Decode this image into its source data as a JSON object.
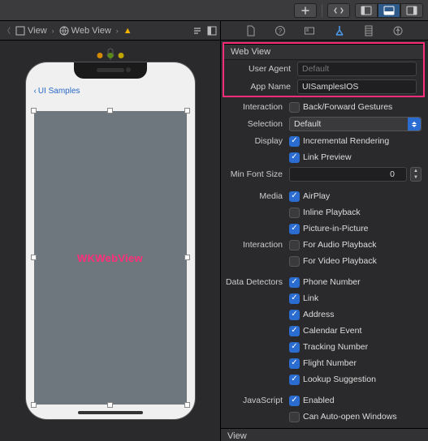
{
  "toolbar": {
    "add_tooltip": "Add",
    "nav_tooltip": "Navigate"
  },
  "breadcrumb": {
    "view": "View",
    "webview": "Web View"
  },
  "canvas": {
    "back_label": "UI Samples",
    "center_label": "WKWebView"
  },
  "inspector": {
    "section_webview": "Web View",
    "section_view": "View",
    "user_agent_label": "User Agent",
    "user_agent_placeholder": "Default",
    "app_name_label": "App Name",
    "app_name_value": "UISamplesIOS",
    "interaction_label": "Interaction",
    "interaction_gestures": "Back/Forward Gestures",
    "selection_label": "Selection",
    "selection_value": "Default",
    "display_label": "Display",
    "display_incremental": "Incremental Rendering",
    "display_linkpreview": "Link Preview",
    "min_font_label": "Min Font Size",
    "min_font_value": "0",
    "media_label": "Media",
    "media_airplay": "AirPlay",
    "media_inline": "Inline Playback",
    "media_pip": "Picture-in-Picture",
    "media_interaction_label": "Interaction",
    "media_audio": "For Audio Playback",
    "media_video": "For Video Playback",
    "detectors_label": "Data Detectors",
    "det_phone": "Phone Number",
    "det_link": "Link",
    "det_address": "Address",
    "det_cal": "Calendar Event",
    "det_track": "Tracking Number",
    "det_flight": "Flight Number",
    "det_lookup": "Lookup Suggestion",
    "js_label": "JavaScript",
    "js_enabled": "Enabled",
    "js_autoopen": "Can Auto-open Windows"
  }
}
